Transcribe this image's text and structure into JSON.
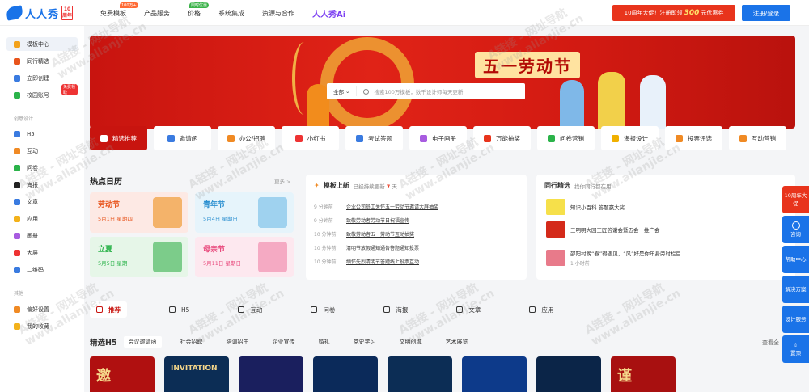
{
  "brand": {
    "name": "人人秀",
    "badge": "10 周年"
  },
  "nav": {
    "items": [
      {
        "label": "免费模板",
        "tag": "100万+"
      },
      {
        "label": "产品服务",
        "tag": ""
      },
      {
        "label": "价格",
        "tag": "限时优惠"
      },
      {
        "label": "系统集成",
        "tag": ""
      },
      {
        "label": "资源与合作",
        "tag": ""
      }
    ],
    "ai": "人人秀Ai"
  },
  "promo": {
    "prefix": "10周年大促！注册即领",
    "amount": "300",
    "suffix": "元优惠券"
  },
  "login_label": "注册/登录",
  "sidebar": {
    "top": [
      {
        "label": "模板中心"
      },
      {
        "label": "同行精选"
      },
      {
        "label": "立即创建"
      },
      {
        "label": "校园账号",
        "tag": "免费领取"
      }
    ],
    "design_head": "创意设计",
    "design": [
      {
        "label": "H5"
      },
      {
        "label": "互动"
      },
      {
        "label": "问卷"
      },
      {
        "label": "海报"
      },
      {
        "label": "文章"
      },
      {
        "label": "应用"
      },
      {
        "label": "画册"
      },
      {
        "label": "大屏"
      },
      {
        "label": "二维码"
      }
    ],
    "other_head": "其他",
    "other": [
      {
        "label": "偏好设置"
      },
      {
        "label": "我的收藏"
      }
    ]
  },
  "banner": {
    "title": "五一劳动节",
    "search_select": "全部",
    "search_placeholder": "搜索100万模板，数千设计师每天更新"
  },
  "categories": [
    {
      "label": "精选推荐",
      "color": "#ffffff"
    },
    {
      "label": "邀请函",
      "color": "#3a7be0"
    },
    {
      "label": "办公/招聘",
      "color": "#f08a24"
    },
    {
      "label": "小红书",
      "color": "#e33"
    },
    {
      "label": "考试答题",
      "color": "#3a7be0"
    },
    {
      "label": "电子画册",
      "color": "#a85ce0"
    },
    {
      "label": "万能抽奖",
      "color": "#e8341c"
    },
    {
      "label": "问卷营销",
      "color": "#2bb34a"
    },
    {
      "label": "海报设计",
      "color": "#f0b000"
    },
    {
      "label": "投票评选",
      "color": "#f08a24"
    },
    {
      "label": "互动营销",
      "color": "#f08a24"
    }
  ],
  "calendar": {
    "title": "热点日历",
    "more": "更多 >",
    "items": [
      {
        "name": "劳动节",
        "date": "5月1日  星期四"
      },
      {
        "name": "青年节",
        "date": "5月4日  星期日"
      },
      {
        "name": "立夏",
        "date": "5月5日  星期一"
      },
      {
        "name": "母亲节",
        "date": "5月11日  星期日"
      }
    ]
  },
  "updates": {
    "title": "模板上新",
    "sub_prefix": "已经持续更新",
    "sub_count": "7",
    "sub_suffix": "天",
    "rows": [
      {
        "time": "9 分钟前",
        "text": "企业公司员工关怀五一劳动节邀请大屏抽奖"
      },
      {
        "time": "9 分钟前",
        "text": "致敬劳动者劳动节日祝福宣传"
      },
      {
        "time": "10 分钟前",
        "text": "致敬劳动者五一劳动节互动抽奖"
      },
      {
        "time": "10 分钟前",
        "text": "清明节放假通知通告答题通知投票"
      },
      {
        "time": "10 分钟前",
        "text": "缅怀先烈清明节答题线上投票互动"
      }
    ]
  },
  "peers": {
    "title": "同行精选",
    "sub": "找你同行都在用",
    "rows": [
      {
        "title": "知识小百科 答题赢大奖",
        "meta": ""
      },
      {
        "title": "三明明大园工匠答谢会暨五会一推广会",
        "meta": ""
      },
      {
        "title": "邵阳村晚“春”得遇见，“风”好是你年身旁时栏目",
        "meta": "1 小时前"
      }
    ]
  },
  "content_tabs": [
    {
      "label": "推荐"
    },
    {
      "label": "H5"
    },
    {
      "label": "互动"
    },
    {
      "label": "问卷"
    },
    {
      "label": "海报"
    },
    {
      "label": "文章"
    },
    {
      "label": "应用"
    }
  ],
  "h5": {
    "title": "精选H5",
    "subtabs": [
      "会议邀请函",
      "社会招聘",
      "培训招生",
      "企业宣传",
      "婚礼",
      "党史学习",
      "文明创城",
      "艺术展览"
    ],
    "right_text": "查看全"
  },
  "thumbs": [
    {
      "text": "邀",
      "bg": "#b01010"
    },
    {
      "text": "INVITATION",
      "bg": "#0c2d55"
    },
    {
      "text": "",
      "bg": "#1a1f5e"
    },
    {
      "text": "",
      "bg": "#0b2a5a"
    },
    {
      "text": "",
      "bg": "#0c2d55"
    },
    {
      "text": "",
      "bg": "#0d3a8a"
    },
    {
      "text": "",
      "bg": "#0b2548"
    },
    {
      "text": "谨",
      "bg": "#a81010"
    }
  ],
  "rightbar": [
    {
      "label": "10周年大促"
    },
    {
      "label": "咨询"
    },
    {
      "label": "帮助中心"
    },
    {
      "label": "解决方案"
    },
    {
      "label": "设计服务"
    },
    {
      "label": "置顶"
    }
  ],
  "watermark": {
    "line1": "A链接 - 网址导航",
    "line2": "www.allanjie.cn"
  }
}
